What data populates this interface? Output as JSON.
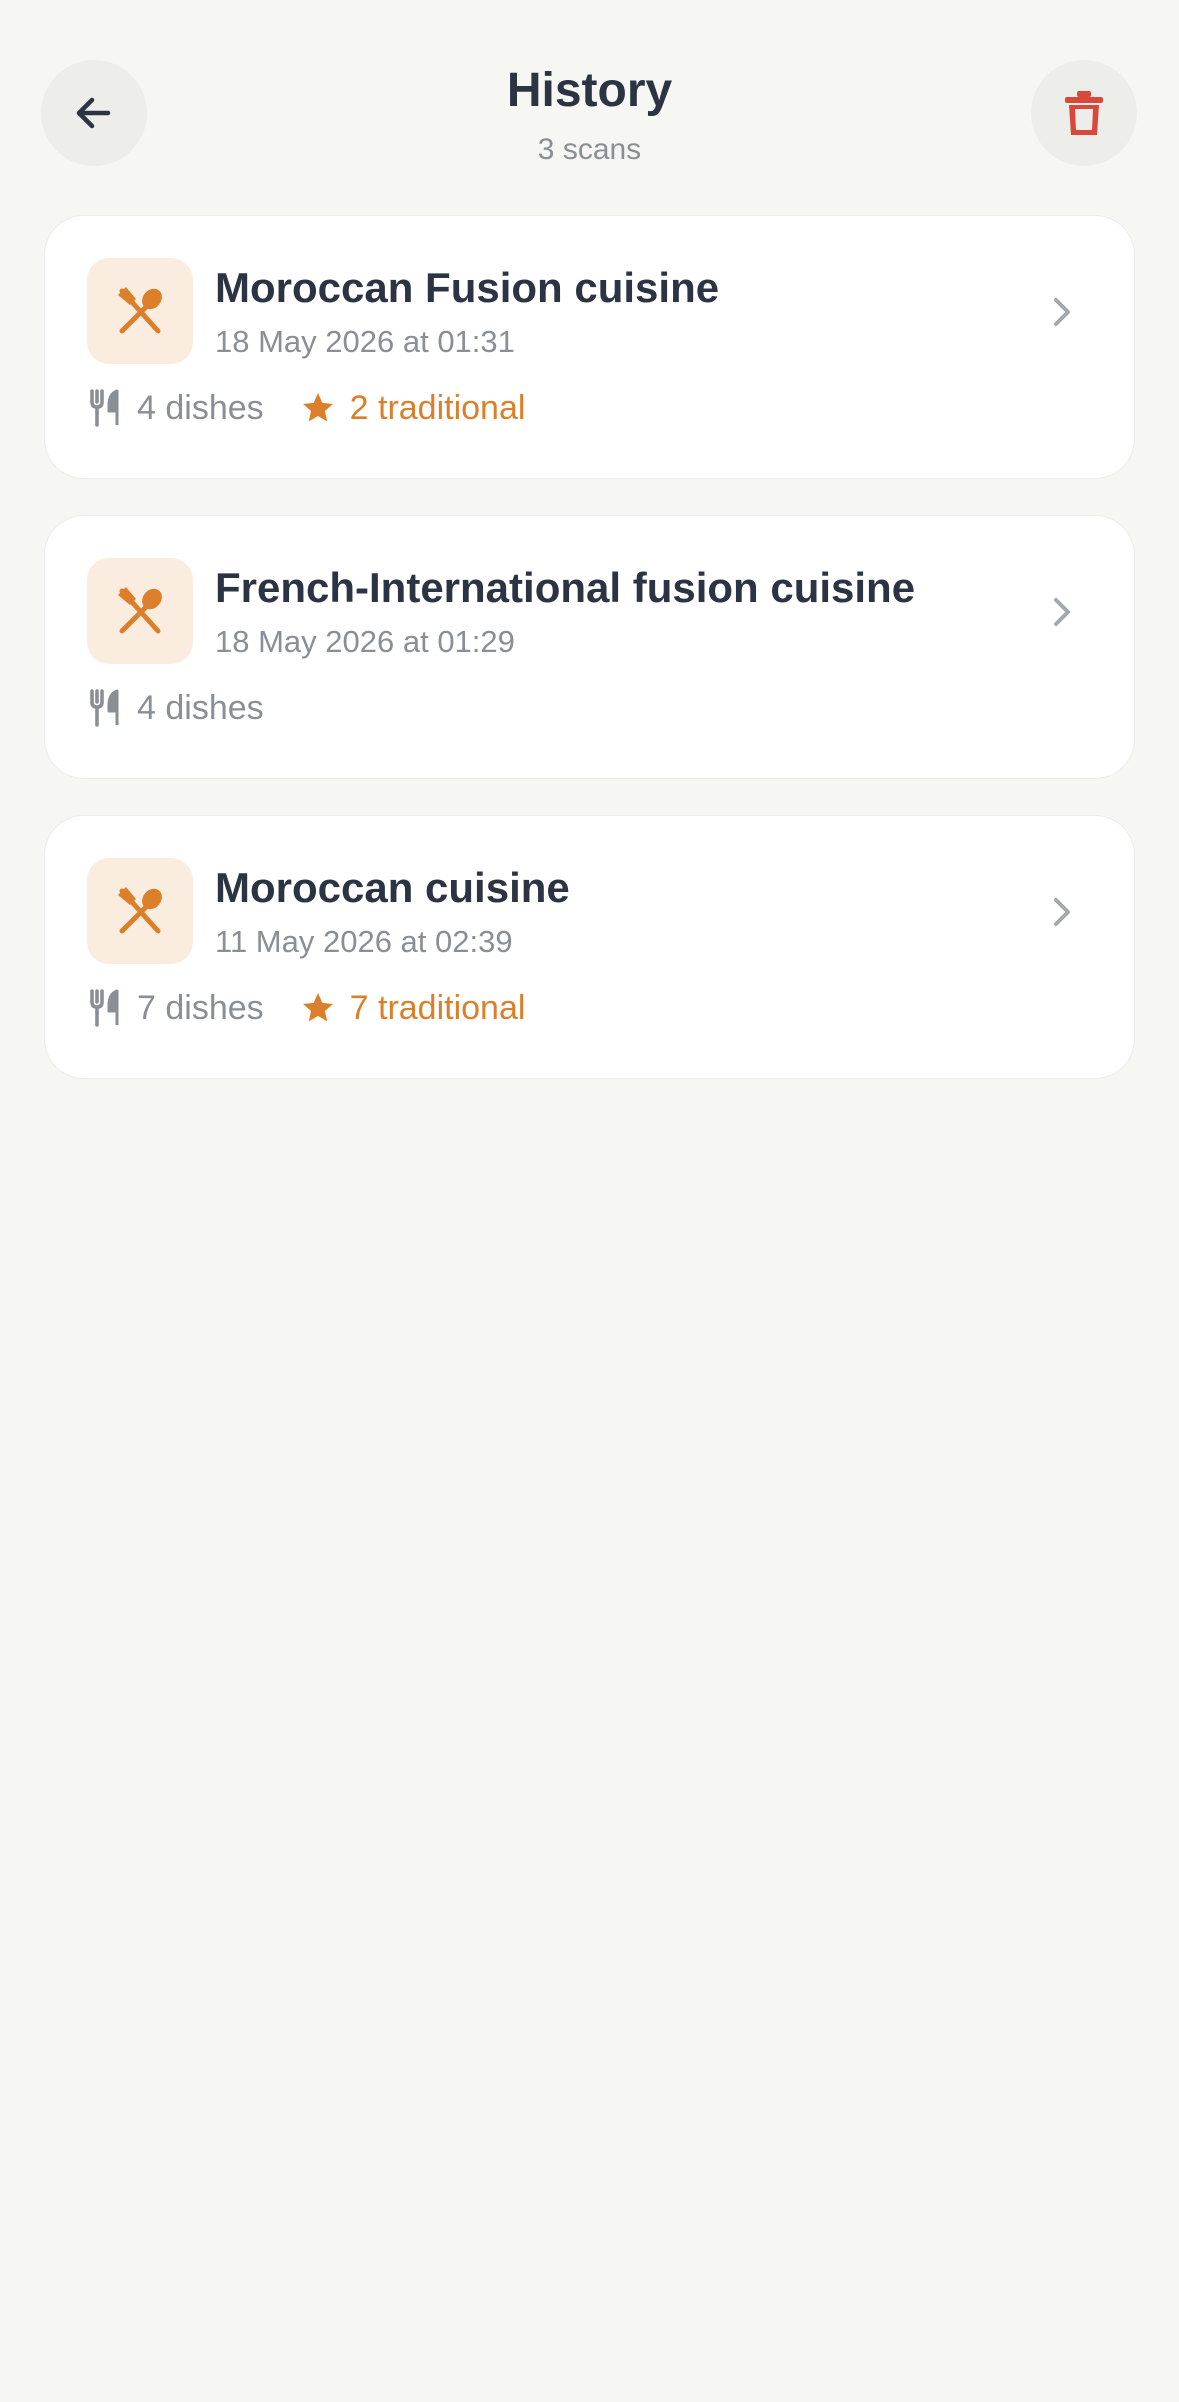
{
  "header": {
    "title": "History",
    "subtitle": "3 scans",
    "back_icon": "arrow-left-icon",
    "delete_icon": "trash-icon"
  },
  "colors": {
    "accent": "#dc7f2b",
    "danger": "#d9483b",
    "text": "#2c3444",
    "muted": "#8a8f96",
    "background": "#f6f6f3",
    "icon_bg": "#fbece0"
  },
  "scans": [
    {
      "title": "Moroccan Fusion cuisine",
      "date": "18 May 2026 at 01:31",
      "dishes": "4 dishes",
      "traditional": "2 traditional"
    },
    {
      "title": "French-International fusion cuisine",
      "date": "18 May 2026 at 01:29",
      "dishes": "4 dishes",
      "traditional": ""
    },
    {
      "title": "Moroccan cuisine",
      "date": "11 May 2026 at 02:39",
      "dishes": "7 dishes",
      "traditional": "7 traditional"
    }
  ]
}
